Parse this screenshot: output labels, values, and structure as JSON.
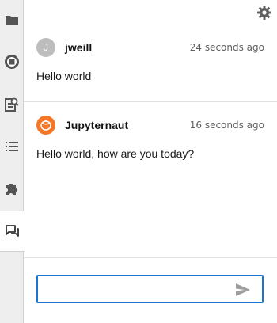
{
  "sidebar": {
    "items": [
      {
        "icon": "folder-icon"
      },
      {
        "icon": "running-icon"
      },
      {
        "icon": "property-inspector-icon"
      },
      {
        "icon": "toc-list-icon"
      },
      {
        "icon": "extension-icon"
      },
      {
        "icon": "chat-icon"
      }
    ]
  },
  "chat": {
    "messages": [
      {
        "author": "jweill",
        "avatar_letter": "J",
        "time": "24 seconds ago",
        "body": "Hello world"
      },
      {
        "author": "Jupyternaut",
        "avatar_letter": "",
        "time": "16 seconds ago",
        "body": "Hello world, how are you today?"
      }
    ],
    "input": {
      "value": "",
      "placeholder": ""
    }
  },
  "colors": {
    "accent": "#1976d2",
    "jupyter_orange": "#f37726",
    "avatar_gray": "#bdbdbd"
  }
}
